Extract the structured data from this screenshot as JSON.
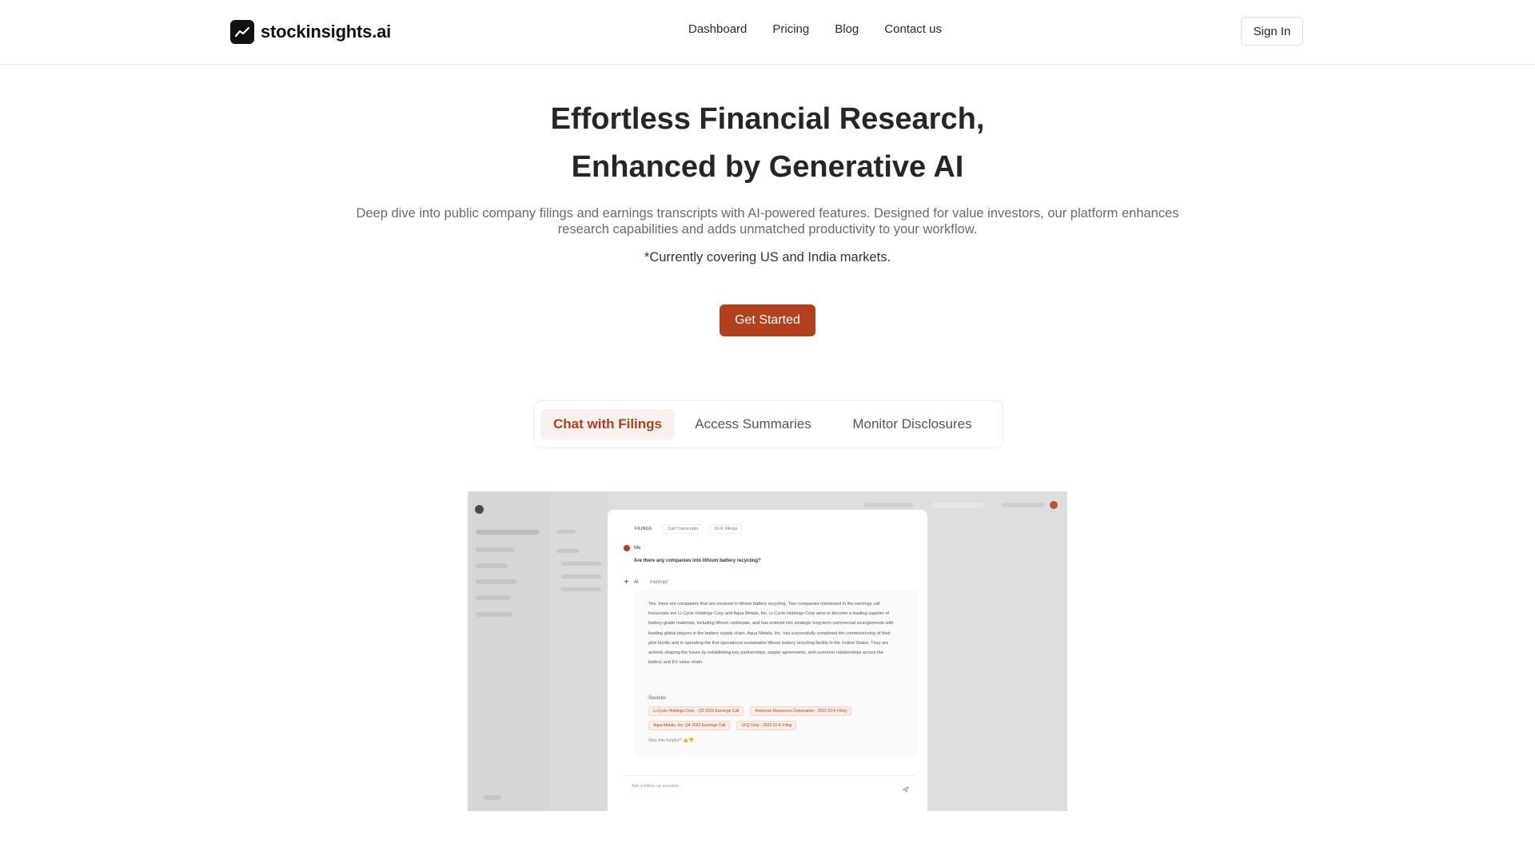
{
  "header": {
    "brand": "stockinsights.ai",
    "nav": [
      {
        "label": "Dashboard"
      },
      {
        "label": "Pricing"
      },
      {
        "label": "Blog"
      },
      {
        "label": "Contact us"
      }
    ],
    "signin_label": "Sign In"
  },
  "hero": {
    "title_line1": "Effortless Financial Research,",
    "title_line2": "Enhanced by Generative AI",
    "description": "Deep dive into public company filings and earnings transcripts with AI-powered features. Designed for value investors, our platform enhances research capabilities and adds unmatched productivity to your workflow.",
    "note": "*Currently covering US and India markets.",
    "cta_label": "Get Started"
  },
  "tabs": [
    {
      "label": "Chat with Filings",
      "active": true
    },
    {
      "label": "Access Summaries",
      "active": false
    },
    {
      "label": "Monitor Disclosures",
      "active": false
    }
  ],
  "demo": {
    "card_tabs": [
      "FILINGS",
      "Call Transcripts",
      "10-K Filings"
    ],
    "me_label": "Me",
    "question": "Are there any companies into lithium battery recycling?",
    "ai_label": "AI",
    "interrupt_label": "Interrupt",
    "answer": "Yes, there are companies that are involved in lithium battery recycling. Two companies mentioned in the earnings call transcripts are Li-Cycle Holdings Corp and Aqua Metals, Inc. Li-Cycle Holdings Corp aims to become a leading supplier of battery-grade materials, including lithium carbonate, and has entered into strategic long-term commercial arrangements with leading global players in the battery supply chain. Aqua Metals, Inc. has successfully completed the commissioning of their pilot facility and is operating the first operational sustainable lithium battery recycling facility in the United States. They are actively shaping the future by establishing key partnerships, supply agreements, and customer relationships across the battery and EV value chain.",
    "sources_label": "Sources",
    "sources": [
      "Li-Cycle Holdings Corp. - Q2 2023 Earnings Call",
      "American Resources Corporation - 2023 10-K Filing",
      "Aqua Metals, Inc. Q4 2022 Earnings Call",
      "LKQ Corp - 2023 10-K Filing"
    ],
    "helpful_label": "Was this helpful?",
    "followup_placeholder": "Ask a follow up question"
  },
  "colors": {
    "accent": "#b23f1e",
    "accent_soft": "#fbf1ec",
    "text_dark": "#262626",
    "text_muted": "#6b6b6b"
  }
}
